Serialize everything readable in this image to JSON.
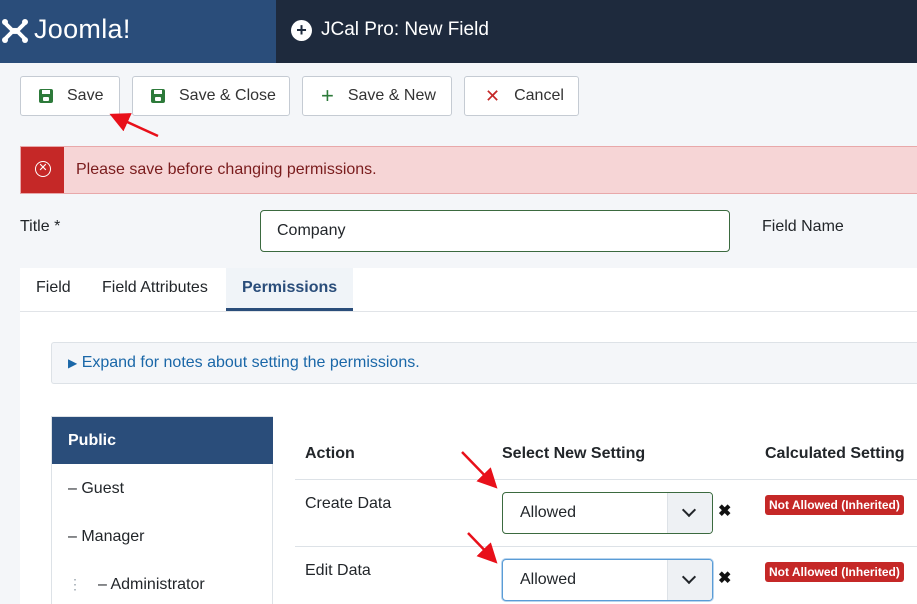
{
  "header": {
    "logo_text": "Joomla!",
    "title": "JCal Pro: New Field"
  },
  "toolbar": {
    "save": "Save",
    "save_close": "Save & Close",
    "save_new": "Save & New",
    "cancel": "Cancel"
  },
  "alert": {
    "message": "Please save before changing permissions."
  },
  "form": {
    "title_label": "Title *",
    "title_value": "Company",
    "field_name_label": "Field Name"
  },
  "tabs": [
    {
      "label": "Field"
    },
    {
      "label": "Field Attributes"
    },
    {
      "label": "Permissions",
      "active": true
    }
  ],
  "notes": {
    "text": "Expand for notes about setting the permissions."
  },
  "groups": [
    {
      "label": "Public",
      "active": true
    },
    {
      "label": "– Guest"
    },
    {
      "label": "– Manager"
    },
    {
      "label": "– Administrator"
    }
  ],
  "permissions": {
    "headers": {
      "action": "Action",
      "select": "Select New Setting",
      "calculated": "Calculated Setting"
    },
    "rows": [
      {
        "action": "Create Data",
        "setting": "Allowed",
        "calculated": "Not Allowed (Inherited)"
      },
      {
        "action": "Edit Data",
        "setting": "Allowed",
        "calculated": "Not Allowed (Inherited)"
      }
    ]
  },
  "colors": {
    "header_bg": "#1e2a3d",
    "brand_bg": "#2a4d7a",
    "save_green": "#2d7a3a",
    "danger_red": "#c52827",
    "link_blue": "#1a67a8"
  }
}
